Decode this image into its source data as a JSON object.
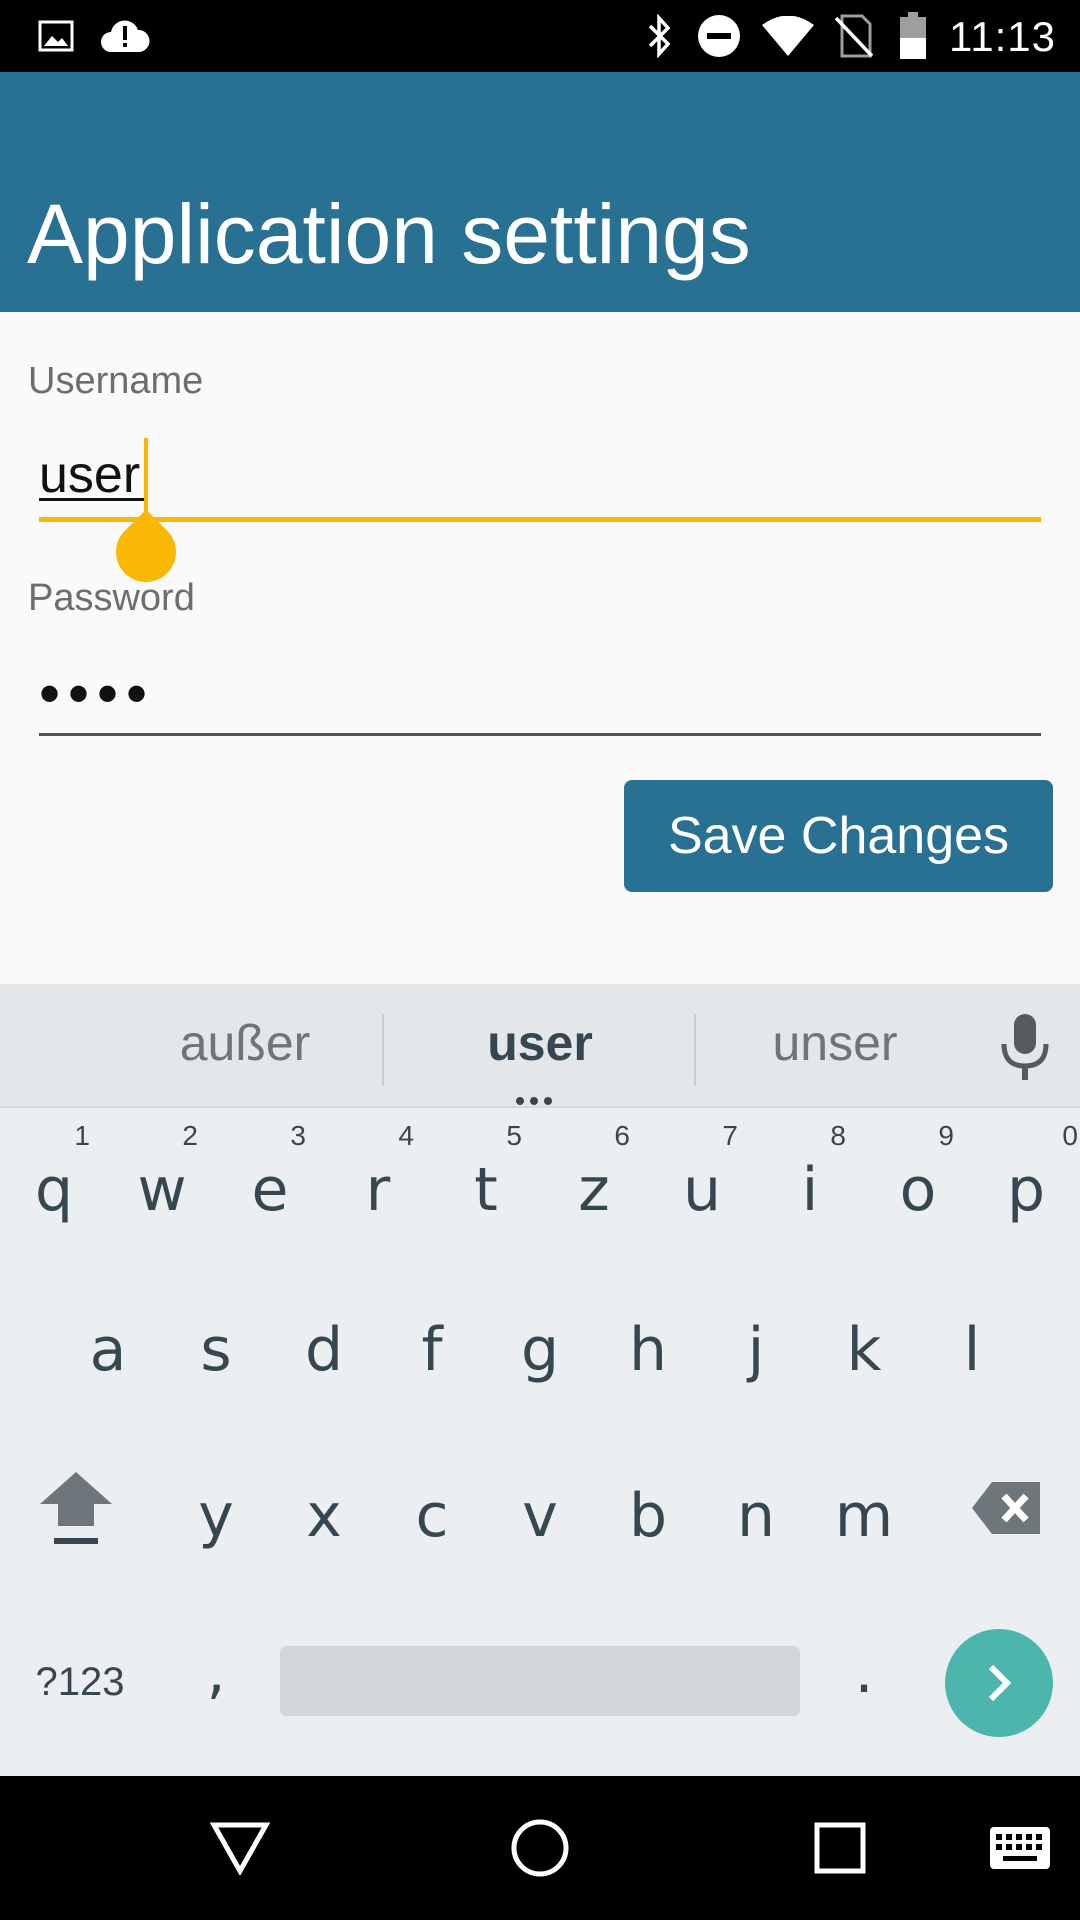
{
  "status_bar": {
    "time": "11:13",
    "icons": [
      "image-icon",
      "cloud-alert-icon",
      "bluetooth-icon",
      "do-not-disturb-icon",
      "wifi-icon",
      "no-sim-icon",
      "battery-icon"
    ]
  },
  "app_bar": {
    "title": "Application settings",
    "color": "#287193"
  },
  "form": {
    "username": {
      "label": "Username",
      "value": "user"
    },
    "password": {
      "label": "Password",
      "value": "••••"
    },
    "save_label": "Save Changes",
    "accent_color": "#f9b706"
  },
  "keyboard": {
    "suggestions": [
      "außer",
      "user",
      "unser"
    ],
    "row1": [
      {
        "k": "q",
        "h": "1"
      },
      {
        "k": "w",
        "h": "2"
      },
      {
        "k": "e",
        "h": "3"
      },
      {
        "k": "r",
        "h": "4"
      },
      {
        "k": "t",
        "h": "5"
      },
      {
        "k": "z",
        "h": "6"
      },
      {
        "k": "u",
        "h": "7"
      },
      {
        "k": "i",
        "h": "8"
      },
      {
        "k": "o",
        "h": "9"
      },
      {
        "k": "p",
        "h": "0"
      }
    ],
    "row2": [
      "a",
      "s",
      "d",
      "f",
      "g",
      "h",
      "j",
      "k",
      "l"
    ],
    "row3": [
      "y",
      "x",
      "c",
      "v",
      "b",
      "n",
      "m"
    ],
    "symbols_label": "?123",
    "comma": ",",
    "period": ".",
    "enter_color": "#4db6ac"
  },
  "nav_bar": {
    "icons": [
      "back-icon",
      "home-icon",
      "recents-icon",
      "keyboard-switch-icon"
    ]
  }
}
